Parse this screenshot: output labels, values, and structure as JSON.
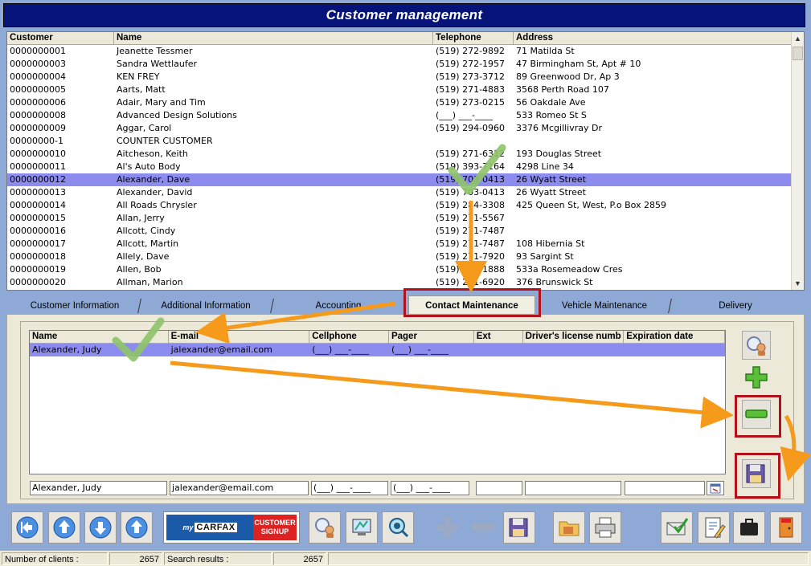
{
  "window": {
    "title": "Customer management"
  },
  "customer_grid": {
    "columns": [
      "Customer",
      "Name",
      "Telephone",
      "Address"
    ],
    "rows": [
      [
        "0000000001",
        "Jeanette Tessmer",
        "(519) 272-9892",
        "71 Matilda St"
      ],
      [
        "0000000003",
        "Sandra Wettlaufer",
        "(519) 272-1957",
        "47 Birmingham St, Apt # 10"
      ],
      [
        "0000000004",
        " KEN FREY",
        "(519) 273-3712",
        "89 Greenwood Dr, Ap 3"
      ],
      [
        "0000000005",
        "Aarts, Matt",
        "(519) 271-4883",
        "3568 Perth Road 107"
      ],
      [
        "0000000006",
        "Adair, Mary and Tim",
        "(519) 273-0215",
        "56 Oakdale Ave"
      ],
      [
        "0000000008",
        "Advanced Design Solutions",
        "(___) ___-____",
        "533 Romeo St S"
      ],
      [
        "0000000009",
        "Aggar, Carol",
        "(519) 294-0960",
        "3376 Mcgillivray Dr"
      ],
      [
        "00000000-1",
        "COUNTER CUSTOMER",
        "",
        ""
      ],
      [
        "0000000010",
        "Aitcheson, Keith",
        "(519) 271-6312",
        "193 Douglas Street"
      ],
      [
        "0000000011",
        "Al's Auto Body",
        "(519) 393-7164",
        "4298 Line 34"
      ],
      [
        "0000000012",
        "Alexander, Dave",
        "(519) 703-0413",
        "26 Wyatt Street"
      ],
      [
        "0000000013",
        "Alexander, David",
        "(519) 703-0413",
        "26 Wyatt Street"
      ],
      [
        "0000000014",
        "All Roads Chrysler",
        "(519) 284-3308",
        "425 Queen St, West, P.o Box 2859"
      ],
      [
        "0000000015",
        "Allan, Jerry",
        "(519) 271-5567",
        ""
      ],
      [
        "0000000016",
        "Allcott, Cindy",
        "(519) 271-7487",
        ""
      ],
      [
        "0000000017",
        "Allcott, Martin",
        "(519) 271-7487",
        "108 Hibernia St"
      ],
      [
        "0000000018",
        "Allely, Dave",
        "(519) 271-7920",
        "93 Sargint St"
      ],
      [
        "0000000019",
        "Allen, Bob",
        "(519) 271-1888",
        "533a Rosemeadow Cres"
      ],
      [
        "0000000020",
        "Allman, Marion",
        "(519) 271-6920",
        "376 Brunswick St"
      ]
    ]
  },
  "tabs": [
    "Customer Information",
    "Additional Information",
    "Accounting",
    "Contact Maintenance",
    "Vehicle Maintenance",
    "Delivery"
  ],
  "contact_grid": {
    "columns": [
      "Name",
      "E-mail",
      "Cellphone",
      "Pager",
      "Ext",
      "Driver's license numb",
      "Expiration date"
    ],
    "rows": [
      [
        "Alexander, Judy",
        "jalexander@email.com",
        "(___) ___-____",
        "(___) ___-____",
        "",
        "",
        ""
      ]
    ]
  },
  "contact_edit": {
    "name": "Alexander, Judy",
    "email": "jalexander@email.com",
    "cellphone": "(___) ___-____",
    "pager": "(___) ___-____",
    "ext": "",
    "license": "",
    "expiration": ""
  },
  "carfax": {
    "my": "my",
    "brand": "CARFAX",
    "badge_line1": "CUSTOMER",
    "badge_line2": "SIGNUP"
  },
  "status": {
    "clients_label": "Number of clients :",
    "clients_value": "2657",
    "search_label": "Search results :",
    "search_value": "2657"
  },
  "icons": {
    "side": [
      "search-person-icon",
      "add-icon",
      "remove-icon",
      "save-icon"
    ],
    "toolbar": [
      "first-record-icon",
      "previous-record-icon",
      "next-record-icon",
      "last-record-icon",
      "search-person-icon",
      "monitor-icon",
      "view-icon",
      "add-icon",
      "remove-icon",
      "save-icon",
      "folder-icon",
      "printer-icon",
      "check-email-icon",
      "edit-document-icon",
      "briefcase-icon",
      "exit-door-icon"
    ]
  },
  "colors": {
    "title_bg": "#06147a",
    "selected_row": "#8c8cef",
    "annotation_orange": "#f59a1b",
    "highlight_red": "#b2131a",
    "check_green": "#8fc36d"
  }
}
